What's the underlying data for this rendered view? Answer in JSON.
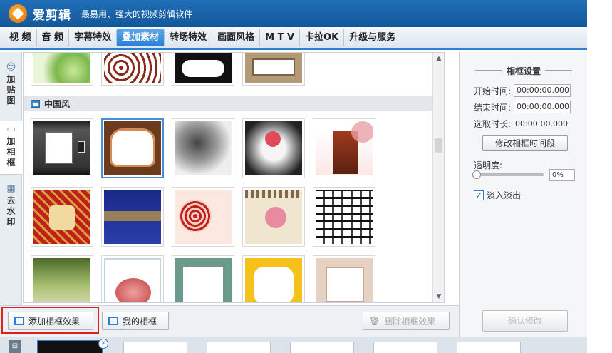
{
  "app": {
    "title": "爱剪辑",
    "subtitle": "最易用、强大的视频剪辑软件"
  },
  "menu": {
    "items": [
      "视 频",
      "音 频",
      "字幕特效",
      "叠加素材",
      "转场特效",
      "画面风格",
      "M T V",
      "卡拉OK",
      "升级与服务"
    ],
    "active_index": 3
  },
  "sidetabs": {
    "items": [
      {
        "label": "加贴图",
        "icon": "sticker-icon"
      },
      {
        "label": "加相框",
        "icon": "frame-add-icon"
      },
      {
        "label": "去水印",
        "icon": "watermark-icon"
      }
    ],
    "active_index": 1
  },
  "gallery": {
    "section_title": "中国风",
    "selected": {
      "row": 0,
      "col": 1
    }
  },
  "toolbar": {
    "add_frame_label": "添加相框效果",
    "my_frames_label": "我的相框",
    "delete_frame_label": "删除相框效果"
  },
  "settings": {
    "title": "相框设置",
    "start_label": "开始时间:",
    "start_value": "00:00:00.000",
    "end_label": "结束时间:",
    "end_value": "00:00:00.000",
    "duration_label": "选取时长:",
    "duration_value": "00:00:00.000",
    "modify_button": "修改相框时间段",
    "opacity_label": "透明度:",
    "opacity_value": "0%",
    "opacity_level": 0,
    "fade_label": "淡入淡出",
    "fade_checked": true,
    "bottom_button": "确认修改"
  },
  "colors": {
    "accent": "#2a7fd3",
    "titlebar": "#1f6fb8",
    "highlight": "#e0201b"
  }
}
